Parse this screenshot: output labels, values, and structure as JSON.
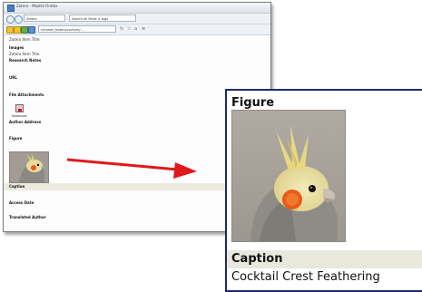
{
  "window": {
    "title": "Zotero - Mozilla Firefox",
    "tab_field": "Zotero",
    "search_field": "Search all fields & tags",
    "address": "chrome://zotero/content/..."
  },
  "fields": {
    "item1": "Zotero Item Title",
    "images_label": "Images",
    "item2": "Zotero Item Title",
    "research_notes_label": "Research Notes",
    "url_label": "URL",
    "file_attachments_label": "File Attachments",
    "attachment_name": "Notebook",
    "author_address_label": "Author Address",
    "figure_label": "Figure",
    "caption_label": "Caption",
    "access_date_label": "Access Date",
    "translated_author_label": "Translated Author"
  },
  "zoom": {
    "figure_label": "Figure",
    "caption_label": "Caption",
    "caption_text": "Cocktail Crest Feathering"
  },
  "colors": {
    "arrow": "#e0191c",
    "zoom_border": "#1d2a6b",
    "caption_bar": "#e8e8dc"
  }
}
